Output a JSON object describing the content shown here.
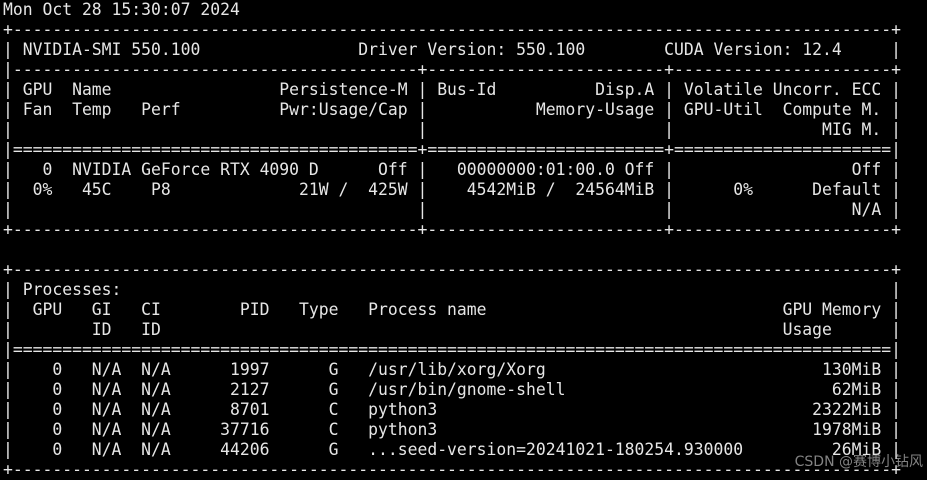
{
  "terminal": {
    "lines": [
      "Mon Oct 28 15:30:07 2024",
      "+-----------------------------------------------------------------------------------------+",
      "| NVIDIA-SMI 550.100                Driver Version: 550.100        CUDA Version: 12.4     |",
      "|-----------------------------------------+------------------------+----------------------+",
      "| GPU  Name                 Persistence-M | Bus-Id          Disp.A | Volatile Uncorr. ECC |",
      "| Fan  Temp   Perf          Pwr:Usage/Cap |           Memory-Usage | GPU-Util  Compute M. |",
      "|                                         |                        |               MIG M. |",
      "|=========================================+========================+======================|",
      "|   0  NVIDIA GeForce RTX 4090 D      Off |   00000000:01:00.0 Off |                  Off |",
      "|  0%   45C    P8             21W /  425W |    4542MiB /  24564MiB |      0%      Default |",
      "|                                         |                        |                  N/A |",
      "+-----------------------------------------+------------------------+----------------------+",
      "",
      "+-----------------------------------------------------------------------------------------+",
      "| Processes:                                                                              |",
      "|  GPU   GI   CI        PID   Type   Process name                              GPU Memory |",
      "|        ID   ID                                                               Usage      |",
      "|=========================================================================================|",
      "|    0   N/A  N/A      1997      G   /usr/lib/xorg/Xorg                            130MiB |",
      "|    0   N/A  N/A      2127      G   /usr/bin/gnome-shell                           62MiB |",
      "|    0   N/A  N/A      8701      C   python3                                      2322MiB |",
      "|    0   N/A  N/A     37716      C   python3                                      1978MiB |",
      "|    0   N/A  N/A     44206      G   ...seed-version=20241021-180254.930000         26MiB |",
      "+-----------------------------------------------------------------------------------------+"
    ]
  },
  "watermark": {
    "text": "CSDN @赛博小钻风"
  },
  "colors": {
    "background": "#000000",
    "foreground": "#e6e6e6"
  }
}
